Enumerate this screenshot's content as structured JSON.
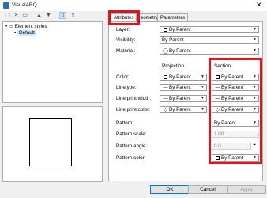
{
  "window": {
    "title": "VisualARQ"
  },
  "toolbar": {
    "icons": [
      "new-style",
      "delete-style",
      "rename-style",
      "move-up",
      "move-down",
      "import-style",
      "export-style"
    ]
  },
  "tree": {
    "root_label": "Element styles",
    "child_label": "Default"
  },
  "tabs": [
    {
      "label": "Attributes"
    },
    {
      "label": "eometry"
    },
    {
      "label": "Parameters"
    }
  ],
  "attributes": {
    "layer": {
      "label": "Layer:",
      "value": "By Parent"
    },
    "visibility": {
      "label": "Visibility:",
      "value": "By Parent"
    },
    "material": {
      "label": "Material:",
      "value": "By Parent"
    },
    "projection_head": "Projection",
    "section_head": "Section",
    "color": {
      "label": "Color:",
      "projection": "By Parent",
      "section": "By Parent"
    },
    "linetype": {
      "label": "Linetype:",
      "projection": "By Parent",
      "section": "By Parent"
    },
    "print_width": {
      "label": "Line print width:",
      "projection": "By Parent",
      "section": "By Parent"
    },
    "print_color": {
      "label": "Line print color:",
      "projection": "By Parent",
      "section": "By Parent"
    },
    "pattern": {
      "label": "Pattern:",
      "value": "By Parent"
    },
    "pattern_scale": {
      "label": "Pattern scale:",
      "value": "1.00"
    },
    "pattern_angle": {
      "label": "Pattern angle:",
      "value": "0.0"
    },
    "pattern_color": {
      "label": "Pattern color:",
      "value": "By Parent"
    }
  },
  "buttons": {
    "ok": "OK",
    "cancel": "Cancel",
    "apply": "Apply"
  },
  "colors": {
    "highlight": "#e8101a",
    "selection": "#cce8ff"
  }
}
